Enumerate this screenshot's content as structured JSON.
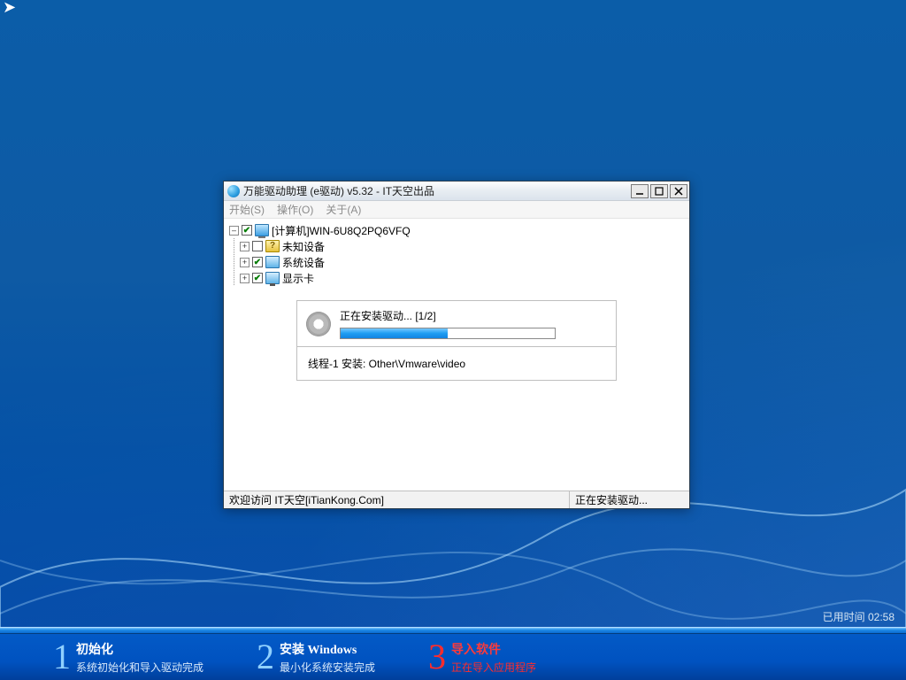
{
  "window": {
    "title": "万能驱动助理 (e驱动) v5.32 - IT天空出品",
    "menu": {
      "start": "开始(S)",
      "operate": "操作(O)",
      "about": "关于(A)"
    }
  },
  "tree": {
    "root": {
      "label": "[计算机]WIN-6U8Q2PQ6VFQ",
      "checked": true,
      "expander": "minus"
    },
    "unknown": {
      "label": "未知设备",
      "checked": false,
      "expander": "plus"
    },
    "system": {
      "label": "系统设备",
      "checked": true,
      "expander": "plus"
    },
    "display": {
      "label": "显示卡",
      "checked": true,
      "expander": "plus"
    }
  },
  "progress": {
    "title": "正在安装驱动... [1/2]",
    "detail": "线程-1 安装:  Other\\Vmware\\video",
    "percent": 50
  },
  "statusbar": {
    "left": "欢迎访问 IT天空[iTianKong.Com]",
    "right": "正在安装驱动..."
  },
  "elapsed": {
    "label": "已用时间",
    "value": "02:58"
  },
  "steps": [
    {
      "num": "1",
      "title": "初始化",
      "sub": "系统初始化和导入驱动完成",
      "active": false
    },
    {
      "num": "2",
      "title": "安装 Windows",
      "sub": "最小化系统安装完成",
      "active": false
    },
    {
      "num": "3",
      "title": "导入软件",
      "sub": "正在导入应用程序",
      "active": true
    }
  ]
}
